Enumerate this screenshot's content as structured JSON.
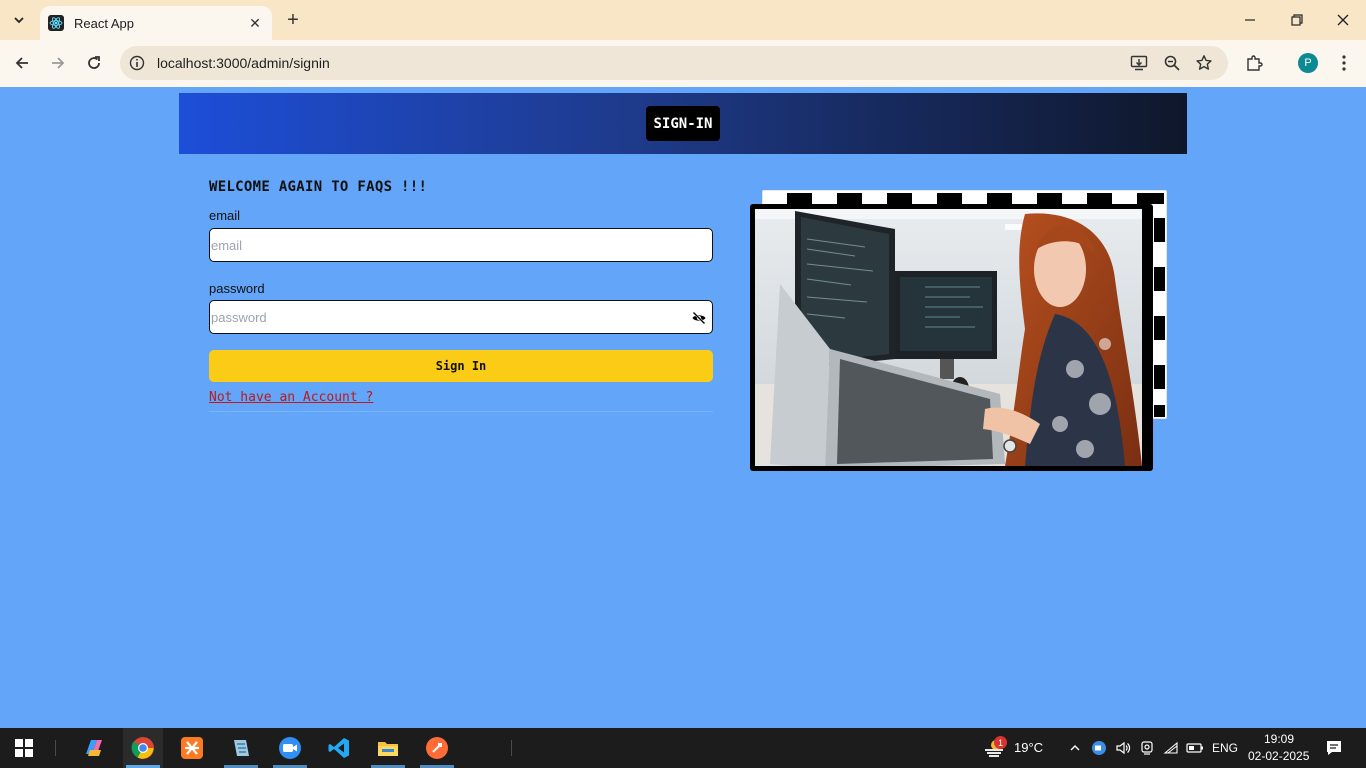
{
  "browser": {
    "tab_title": "React App",
    "url": "localhost:3000/admin/signin",
    "profile_initial": "P"
  },
  "header": {
    "title": "SIGN-IN"
  },
  "form": {
    "welcome": "WELCOME AGAIN TO FAQS !!!",
    "email_label": "email",
    "email_placeholder": "email",
    "password_label": "password",
    "password_placeholder": "password",
    "submit_label": "Sign In",
    "signup_link": "Not have an Account ?"
  },
  "taskbar": {
    "temperature": "19°C",
    "weather_badge": "1",
    "language": "ENG",
    "time": "19:09",
    "date": "02-02-2025"
  },
  "colors": {
    "page_background": "#63a5f8",
    "accent_button": "#facc15",
    "link": "#b91c1c"
  }
}
